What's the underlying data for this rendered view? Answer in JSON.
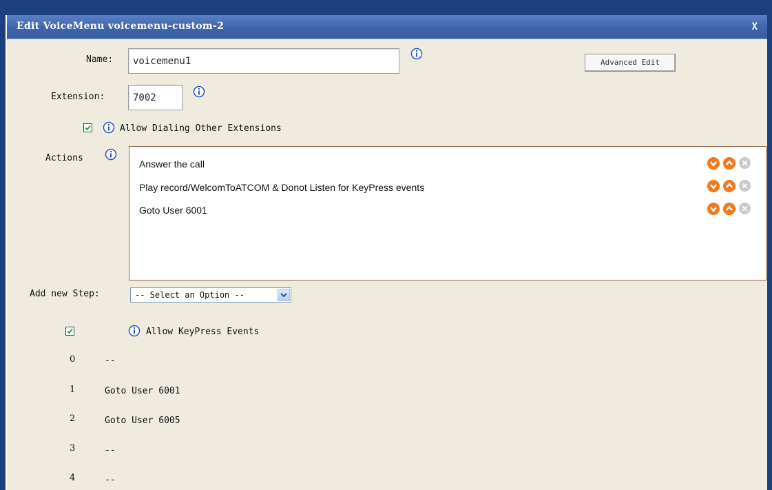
{
  "dialog": {
    "title": "Edit VoiceMenu voicemenu-custom-2",
    "close_label": "X"
  },
  "form": {
    "name_label": "Name:",
    "name_value": "voicemenu1",
    "advanced_edit_label": "Advanced Edit",
    "extension_label": "Extension:",
    "extension_value": "7002",
    "allow_dialing_label": "Allow Dialing Other Extensions",
    "allow_dialing_checked": true,
    "actions_label": "Actions",
    "actions": [
      {
        "text": "Answer the call"
      },
      {
        "text": "Play record/WelcomToATCOM & Donot Listen for KeyPress events"
      },
      {
        "text": "Goto User 6001"
      }
    ],
    "add_step_label": "Add new Step:",
    "add_step_selected": "-- Select an Option --",
    "allow_keypress_label": "Allow KeyPress Events",
    "allow_keypress_checked": true,
    "keypress_events": [
      {
        "key": "0",
        "value": "--"
      },
      {
        "key": "1",
        "value": "Goto User 6001"
      },
      {
        "key": "2",
        "value": "Goto User 6005"
      },
      {
        "key": "3",
        "value": "--"
      },
      {
        "key": "4",
        "value": "--"
      }
    ]
  },
  "icons": {
    "info": "info-icon",
    "move_down": "move-down-icon",
    "move_up": "move-up-icon",
    "delete": "delete-icon",
    "dropdown": "chevron-down-icon"
  },
  "colors": {
    "background": "#1d3f7e",
    "panel": "#efebde",
    "titlebar": "#3e64ad",
    "accent_orange": "#f07a1f",
    "info_blue": "#2a55c6"
  }
}
